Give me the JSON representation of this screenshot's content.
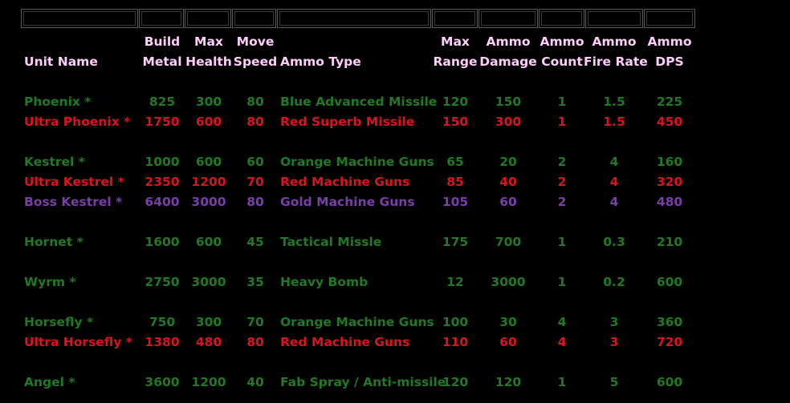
{
  "colors": {
    "background": "#000000",
    "header": "#ffcdfa",
    "standard": "#1f7a23",
    "ultra": "#d9141c",
    "boss": "#7a3ea8"
  },
  "header": {
    "unit_name": "Unit Name",
    "build_metal": [
      "Build",
      "Metal"
    ],
    "max_health": [
      "Max",
      "Health"
    ],
    "move_speed": [
      "Move",
      "Speed"
    ],
    "ammo_type": "Ammo Type",
    "max_range": [
      "Max",
      "Range"
    ],
    "ammo_damage": [
      "Ammo",
      "Damage"
    ],
    "ammo_count": [
      "Ammo",
      "Count"
    ],
    "ammo_fire_rate": [
      "Ammo",
      "Fire Rate"
    ],
    "ammo_dps": [
      "Ammo",
      "DPS"
    ]
  },
  "rows": [
    {
      "tier": "green",
      "name": "Phoenix *",
      "metal": "825",
      "health": "300",
      "speed": "80",
      "ammo": "Blue Advanced Missile",
      "range": "120",
      "damage": "150",
      "count": "1",
      "rate": "1.5",
      "dps": "225"
    },
    {
      "tier": "red",
      "name": "Ultra Phoenix *",
      "metal": "1750",
      "health": "600",
      "speed": "80",
      "ammo": "Red Superb Missile",
      "range": "150",
      "damage": "300",
      "count": "1",
      "rate": "1.5",
      "dps": "450"
    },
    {
      "tier": "green",
      "name": "Kestrel *",
      "metal": "1000",
      "health": "600",
      "speed": "60",
      "ammo": "Orange Machine Guns",
      "range": "65",
      "damage": "20",
      "count": "2",
      "rate": "4",
      "dps": "160"
    },
    {
      "tier": "red",
      "name": "Ultra Kestrel *",
      "metal": "2350",
      "health": "1200",
      "speed": "70",
      "ammo": "Red Machine Guns",
      "range": "85",
      "damage": "40",
      "count": "2",
      "rate": "4",
      "dps": "320"
    },
    {
      "tier": "purple",
      "name": "Boss Kestrel *",
      "metal": "6400",
      "health": "3000",
      "speed": "80",
      "ammo": "Gold Machine Guns",
      "range": "105",
      "damage": "60",
      "count": "2",
      "rate": "4",
      "dps": "480"
    },
    {
      "tier": "green",
      "name": "Hornet *",
      "metal": "1600",
      "health": "600",
      "speed": "45",
      "ammo": "Tactical Missle",
      "range": "175",
      "damage": "700",
      "count": "1",
      "rate": "0.3",
      "dps": "210"
    },
    {
      "tier": "green",
      "name": "Wyrm *",
      "metal": "2750",
      "health": "3000",
      "speed": "35",
      "ammo": "Heavy Bomb",
      "range": "12",
      "damage": "3000",
      "count": "1",
      "rate": "0.2",
      "dps": "600"
    },
    {
      "tier": "green",
      "name": "Horsefly *",
      "metal": "750",
      "health": "300",
      "speed": "70",
      "ammo": "Orange Machine Guns",
      "range": "100",
      "damage": "30",
      "count": "4",
      "rate": "3",
      "dps": "360"
    },
    {
      "tier": "red",
      "name": "Ultra Horsefly *",
      "metal": "1380",
      "health": "480",
      "speed": "80",
      "ammo": "Red Machine Guns",
      "range": "110",
      "damage": "60",
      "count": "4",
      "rate": "3",
      "dps": "720"
    },
    {
      "tier": "green",
      "name": "Angel *",
      "metal": "3600",
      "health": "1200",
      "speed": "40",
      "ammo": "Fab Spray / Anti-missile",
      "range": "120",
      "damage": "120",
      "count": "1",
      "rate": "5",
      "dps": "600"
    }
  ]
}
